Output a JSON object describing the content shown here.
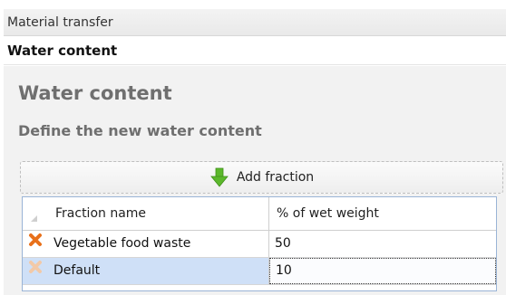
{
  "breadcrumb": {
    "text": "Material transfer"
  },
  "subtitle": {
    "text": "Water content"
  },
  "main": {
    "title": "Water content",
    "subtitle": "Define the new water content",
    "add_button_label": "Add fraction"
  },
  "grid": {
    "columns": [
      "Fraction name",
      "% of wet weight"
    ],
    "rows": [
      {
        "name": "Vegetable food waste",
        "value": "50",
        "delete_enabled": true
      },
      {
        "name": "Default",
        "value": "10",
        "delete_enabled": false
      }
    ]
  },
  "colors": {
    "delete_active": "#e8701a",
    "delete_disabled": "#f2c9a8",
    "add_arrow": "#5cb82c",
    "selected_row": "#cfe0f7",
    "heading_gray": "#6f6f6f"
  },
  "icons": {
    "add": "down-arrow-icon",
    "delete": "delete-x-icon"
  }
}
